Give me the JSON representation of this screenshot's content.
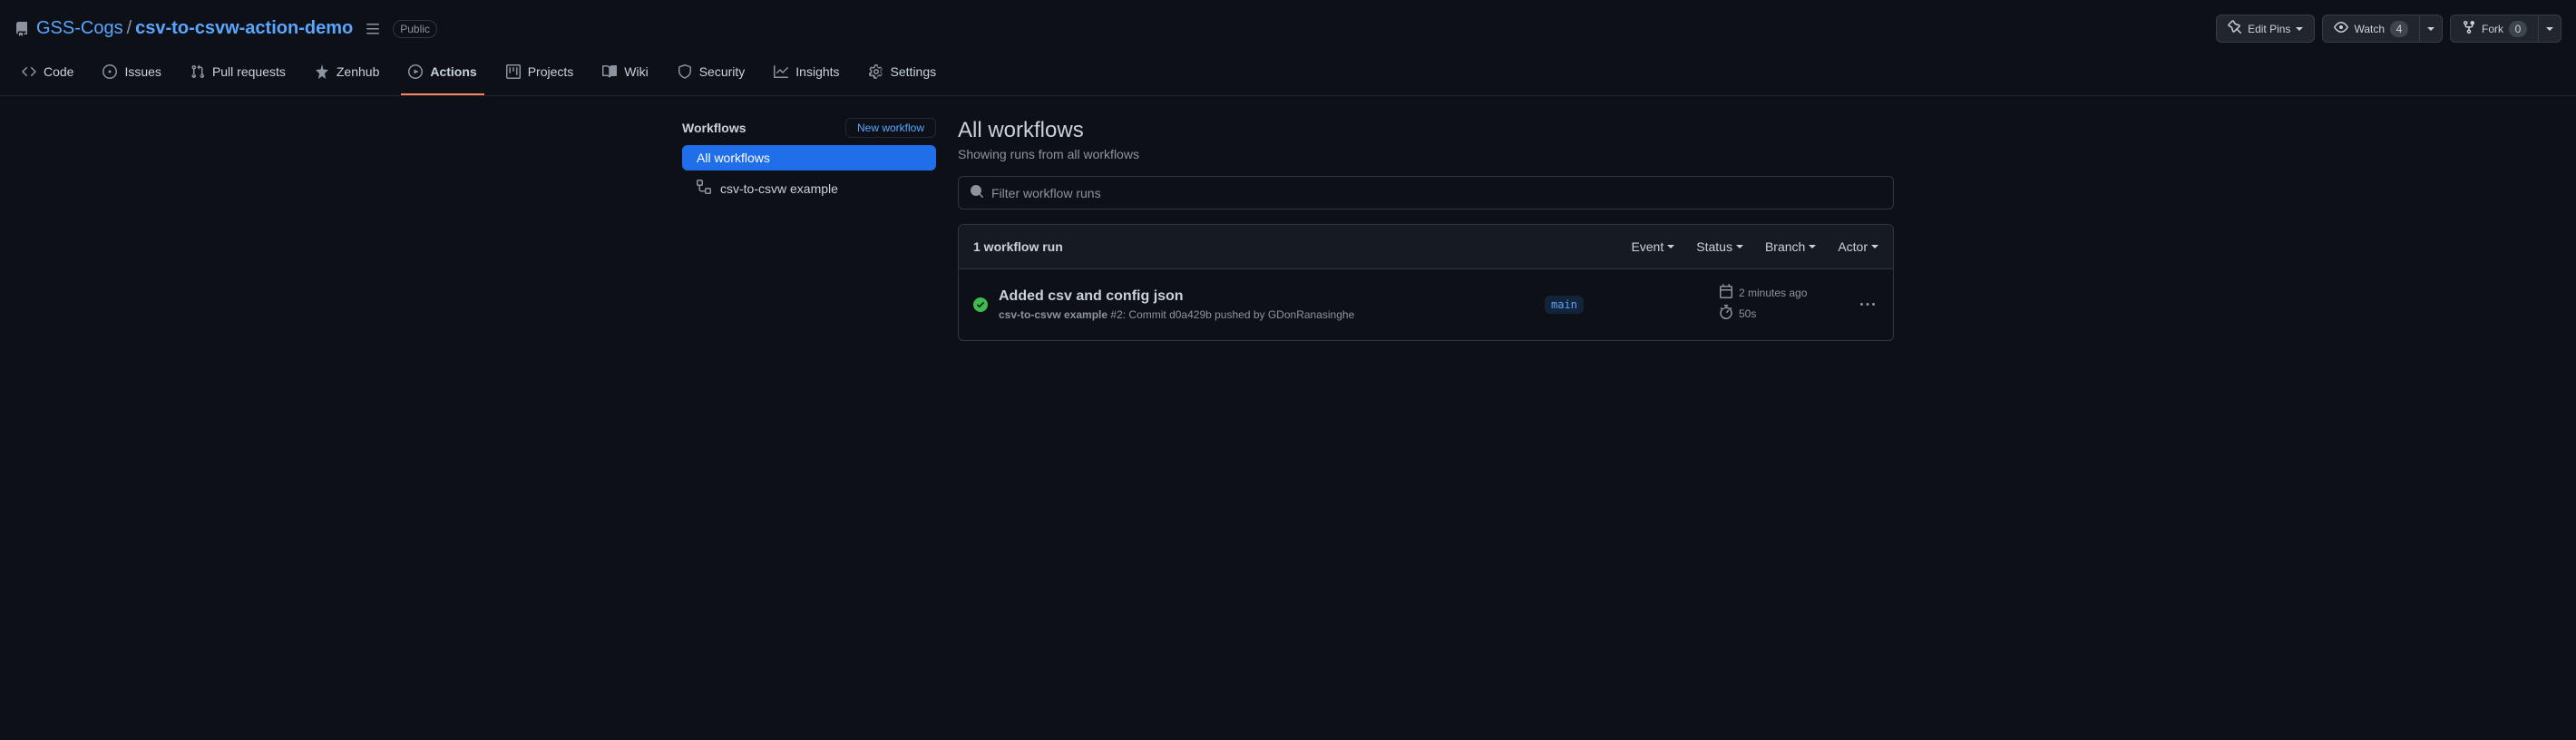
{
  "header": {
    "owner": "GSS-Cogs",
    "repo": "csv-to-csvw-action-demo",
    "visibility": "Public",
    "edit_pins": "Edit Pins",
    "watch": "Watch",
    "watch_count": "4",
    "fork": "Fork",
    "fork_count": "0"
  },
  "tabs": {
    "code": "Code",
    "issues": "Issues",
    "pulls": "Pull requests",
    "zenhub": "Zenhub",
    "actions": "Actions",
    "projects": "Projects",
    "wiki": "Wiki",
    "security": "Security",
    "insights": "Insights",
    "settings": "Settings"
  },
  "sidebar": {
    "title": "Workflows",
    "new_workflow": "New workflow",
    "all_workflows": "All workflows",
    "workflow_0": "csv-to-csvw example"
  },
  "content": {
    "title": "All workflows",
    "subtitle": "Showing runs from all workflows",
    "search_placeholder": "Filter workflow runs",
    "run_count": "1 workflow run",
    "filter_event": "Event",
    "filter_status": "Status",
    "filter_branch": "Branch",
    "filter_actor": "Actor"
  },
  "runs": {
    "0": {
      "title": "Added csv and config json",
      "workflow_name": "csv-to-csvw example",
      "meta_rest": " #2: Commit d0a429b pushed by GDonRanasinghe",
      "branch": "main",
      "time_ago": "2 minutes ago",
      "duration": "50s"
    }
  }
}
